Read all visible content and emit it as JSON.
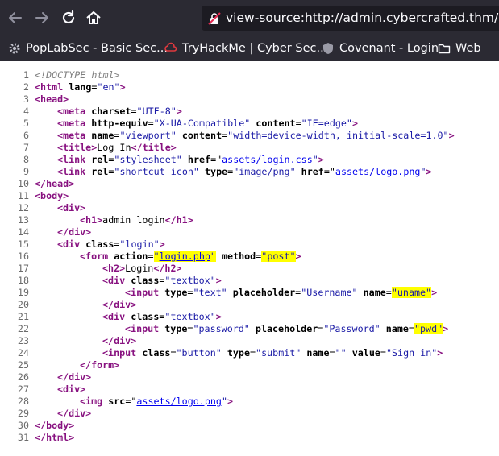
{
  "browser": {
    "url": "view-source:http://admin.cybercrafted.thm/",
    "nav_icons": [
      "back-arrow-icon",
      "forward-arrow-icon",
      "reload-icon",
      "home-icon"
    ]
  },
  "bookmarks": [
    {
      "icon": "gear-icon",
      "label": "PopLabSec - Basic Sec..."
    },
    {
      "icon": "tryhackme-icon",
      "label": "TryHackMe | Cyber Sec..."
    },
    {
      "icon": "covenant-icon",
      "label": "Covenant - Login"
    },
    {
      "icon": "folder-icon",
      "label": "Web"
    }
  ],
  "colors": {
    "tag": "#881280",
    "value": "#1a1aa6",
    "highlight": "#ffff00",
    "link": "#0000ee",
    "comment": "#808080"
  },
  "source_lines": [
    {
      "n": "1",
      "indent": 0,
      "tokens": [
        {
          "t": "comment",
          "v": "<!DOCTYPE html>"
        }
      ]
    },
    {
      "n": "2",
      "indent": 0,
      "tokens": [
        {
          "t": "tag",
          "v": "<html "
        },
        {
          "t": "attr",
          "v": "lang"
        },
        {
          "t": "text",
          "v": "="
        },
        {
          "t": "val",
          "v": "\"en\""
        },
        {
          "t": "tag",
          "v": ">"
        }
      ]
    },
    {
      "n": "3",
      "indent": 0,
      "tokens": [
        {
          "t": "tag",
          "v": "<head>"
        }
      ]
    },
    {
      "n": "4",
      "indent": 1,
      "tokens": [
        {
          "t": "tag",
          "v": "<meta "
        },
        {
          "t": "attr",
          "v": "charset"
        },
        {
          "t": "text",
          "v": "="
        },
        {
          "t": "val",
          "v": "\"UTF-8\""
        },
        {
          "t": "tag",
          "v": ">"
        }
      ]
    },
    {
      "n": "5",
      "indent": 1,
      "tokens": [
        {
          "t": "tag",
          "v": "<meta "
        },
        {
          "t": "attr",
          "v": "http-equiv"
        },
        {
          "t": "text",
          "v": "="
        },
        {
          "t": "val",
          "v": "\"X-UA-Compatible\""
        },
        {
          "t": "text",
          "v": " "
        },
        {
          "t": "attr",
          "v": "content"
        },
        {
          "t": "text",
          "v": "="
        },
        {
          "t": "val",
          "v": "\"IE=edge\""
        },
        {
          "t": "tag",
          "v": ">"
        }
      ]
    },
    {
      "n": "6",
      "indent": 1,
      "tokens": [
        {
          "t": "tag",
          "v": "<meta "
        },
        {
          "t": "attr",
          "v": "name"
        },
        {
          "t": "text",
          "v": "="
        },
        {
          "t": "val",
          "v": "\"viewport\""
        },
        {
          "t": "text",
          "v": " "
        },
        {
          "t": "attr",
          "v": "content"
        },
        {
          "t": "text",
          "v": "="
        },
        {
          "t": "val",
          "v": "\"width=device-width, initial-scale=1.0\""
        },
        {
          "t": "tag",
          "v": ">"
        }
      ]
    },
    {
      "n": "7",
      "indent": 1,
      "tokens": [
        {
          "t": "tag",
          "v": "<title>"
        },
        {
          "t": "text",
          "v": "Log In"
        },
        {
          "t": "tag",
          "v": "</title>"
        }
      ]
    },
    {
      "n": "8",
      "indent": 1,
      "tokens": [
        {
          "t": "tag",
          "v": "<link "
        },
        {
          "t": "attr",
          "v": "rel"
        },
        {
          "t": "text",
          "v": "="
        },
        {
          "t": "val",
          "v": "\"stylesheet\""
        },
        {
          "t": "text",
          "v": " "
        },
        {
          "t": "attr",
          "v": "href"
        },
        {
          "t": "text",
          "v": "=\""
        },
        {
          "t": "link",
          "v": "assets/login.css"
        },
        {
          "t": "val",
          "v": "\""
        },
        {
          "t": "tag",
          "v": ">"
        }
      ]
    },
    {
      "n": "9",
      "indent": 1,
      "tokens": [
        {
          "t": "tag",
          "v": "<link "
        },
        {
          "t": "attr",
          "v": "rel"
        },
        {
          "t": "text",
          "v": "="
        },
        {
          "t": "val",
          "v": "\"shortcut icon\""
        },
        {
          "t": "text",
          "v": " "
        },
        {
          "t": "attr",
          "v": "type"
        },
        {
          "t": "text",
          "v": "="
        },
        {
          "t": "val",
          "v": "\"image/png\""
        },
        {
          "t": "text",
          "v": " "
        },
        {
          "t": "attr",
          "v": "href"
        },
        {
          "t": "text",
          "v": "=\""
        },
        {
          "t": "link",
          "v": "assets/logo.png"
        },
        {
          "t": "val",
          "v": "\""
        },
        {
          "t": "tag",
          "v": ">"
        }
      ]
    },
    {
      "n": "10",
      "indent": 0,
      "tokens": [
        {
          "t": "tag",
          "v": "</head>"
        }
      ]
    },
    {
      "n": "11",
      "indent": 0,
      "tokens": [
        {
          "t": "tag",
          "v": "<body>"
        }
      ]
    },
    {
      "n": "12",
      "indent": 1,
      "tokens": [
        {
          "t": "tag",
          "v": "<div>"
        }
      ]
    },
    {
      "n": "13",
      "indent": 2,
      "tokens": [
        {
          "t": "tag",
          "v": "<h1>"
        },
        {
          "t": "text",
          "v": "admin login"
        },
        {
          "t": "tag",
          "v": "</h1>"
        }
      ]
    },
    {
      "n": "14",
      "indent": 1,
      "tokens": [
        {
          "t": "tag",
          "v": "</div>"
        }
      ]
    },
    {
      "n": "15",
      "indent": 1,
      "tokens": [
        {
          "t": "tag",
          "v": "<div "
        },
        {
          "t": "attr",
          "v": "class"
        },
        {
          "t": "text",
          "v": "="
        },
        {
          "t": "val",
          "v": "\"login\""
        },
        {
          "t": "tag",
          "v": ">"
        }
      ]
    },
    {
      "n": "16",
      "indent": 2,
      "tokens": [
        {
          "t": "tag",
          "v": "<form "
        },
        {
          "t": "attr",
          "v": "action"
        },
        {
          "t": "text",
          "v": "="
        },
        {
          "t": "val",
          "v": "\"",
          "hl": true
        },
        {
          "t": "link",
          "v": "login.php",
          "hl": true
        },
        {
          "t": "val",
          "v": "\"",
          "hl": true
        },
        {
          "t": "text",
          "v": " "
        },
        {
          "t": "attr",
          "v": "method"
        },
        {
          "t": "text",
          "v": "="
        },
        {
          "t": "val",
          "v": "\"post\"",
          "hl": true
        },
        {
          "t": "tag",
          "v": ">"
        }
      ]
    },
    {
      "n": "17",
      "indent": 3,
      "tokens": [
        {
          "t": "tag",
          "v": "<h2>"
        },
        {
          "t": "text",
          "v": "Login"
        },
        {
          "t": "tag",
          "v": "</h2>"
        }
      ]
    },
    {
      "n": "18",
      "indent": 3,
      "tokens": [
        {
          "t": "tag",
          "v": "<div "
        },
        {
          "t": "attr",
          "v": "class"
        },
        {
          "t": "text",
          "v": "="
        },
        {
          "t": "val",
          "v": "\"textbox\""
        },
        {
          "t": "tag",
          "v": ">"
        }
      ]
    },
    {
      "n": "19",
      "indent": 4,
      "tokens": [
        {
          "t": "tag",
          "v": "<input "
        },
        {
          "t": "attr",
          "v": "type"
        },
        {
          "t": "text",
          "v": "="
        },
        {
          "t": "val",
          "v": "\"text\""
        },
        {
          "t": "text",
          "v": " "
        },
        {
          "t": "attr",
          "v": "placeholder"
        },
        {
          "t": "text",
          "v": "="
        },
        {
          "t": "val",
          "v": "\"Username\""
        },
        {
          "t": "text",
          "v": " "
        },
        {
          "t": "attr",
          "v": "name"
        },
        {
          "t": "text",
          "v": "="
        },
        {
          "t": "val",
          "v": "\"uname\"",
          "hl": true
        },
        {
          "t": "tag",
          "v": ">"
        }
      ]
    },
    {
      "n": "20",
      "indent": 3,
      "tokens": [
        {
          "t": "tag",
          "v": "</div>"
        }
      ]
    },
    {
      "n": "21",
      "indent": 3,
      "tokens": [
        {
          "t": "tag",
          "v": "<div "
        },
        {
          "t": "attr",
          "v": "class"
        },
        {
          "t": "text",
          "v": "="
        },
        {
          "t": "val",
          "v": "\"textbox\""
        },
        {
          "t": "tag",
          "v": ">"
        }
      ]
    },
    {
      "n": "22",
      "indent": 4,
      "tokens": [
        {
          "t": "tag",
          "v": "<input "
        },
        {
          "t": "attr",
          "v": "type"
        },
        {
          "t": "text",
          "v": "="
        },
        {
          "t": "val",
          "v": "\"password\""
        },
        {
          "t": "text",
          "v": " "
        },
        {
          "t": "attr",
          "v": "placeholder"
        },
        {
          "t": "text",
          "v": "="
        },
        {
          "t": "val",
          "v": "\"Password\""
        },
        {
          "t": "text",
          "v": " "
        },
        {
          "t": "attr",
          "v": "name"
        },
        {
          "t": "text",
          "v": "="
        },
        {
          "t": "val",
          "v": "\"pwd\"",
          "hl": true
        },
        {
          "t": "tag",
          "v": ">"
        }
      ]
    },
    {
      "n": "23",
      "indent": 3,
      "tokens": [
        {
          "t": "tag",
          "v": "</div>"
        }
      ]
    },
    {
      "n": "24",
      "indent": 3,
      "tokens": [
        {
          "t": "tag",
          "v": "<input "
        },
        {
          "t": "attr",
          "v": "class"
        },
        {
          "t": "text",
          "v": "="
        },
        {
          "t": "val",
          "v": "\"button\""
        },
        {
          "t": "text",
          "v": " "
        },
        {
          "t": "attr",
          "v": "type"
        },
        {
          "t": "text",
          "v": "="
        },
        {
          "t": "val",
          "v": "\"submit\""
        },
        {
          "t": "text",
          "v": " "
        },
        {
          "t": "attr",
          "v": "name"
        },
        {
          "t": "text",
          "v": "="
        },
        {
          "t": "val",
          "v": "\"\""
        },
        {
          "t": "text",
          "v": " "
        },
        {
          "t": "attr",
          "v": "value"
        },
        {
          "t": "text",
          "v": "="
        },
        {
          "t": "val",
          "v": "\"Sign in\""
        },
        {
          "t": "tag",
          "v": ">"
        }
      ]
    },
    {
      "n": "25",
      "indent": 2,
      "tokens": [
        {
          "t": "tag",
          "v": "</form>"
        }
      ]
    },
    {
      "n": "26",
      "indent": 1,
      "tokens": [
        {
          "t": "tag",
          "v": "</div>"
        }
      ]
    },
    {
      "n": "27",
      "indent": 1,
      "tokens": [
        {
          "t": "tag",
          "v": "<div>"
        }
      ]
    },
    {
      "n": "28",
      "indent": 2,
      "tokens": [
        {
          "t": "tag",
          "v": "<img "
        },
        {
          "t": "attr",
          "v": "src"
        },
        {
          "t": "text",
          "v": "=\""
        },
        {
          "t": "link",
          "v": "assets/logo.png"
        },
        {
          "t": "val",
          "v": "\""
        },
        {
          "t": "tag",
          "v": ">"
        }
      ]
    },
    {
      "n": "29",
      "indent": 1,
      "tokens": [
        {
          "t": "tag",
          "v": "</div>"
        }
      ]
    },
    {
      "n": "30",
      "indent": 0,
      "tokens": [
        {
          "t": "tag",
          "v": "</body>"
        }
      ]
    },
    {
      "n": "31",
      "indent": 0,
      "tokens": [
        {
          "t": "tag",
          "v": "</html>"
        }
      ]
    }
  ]
}
